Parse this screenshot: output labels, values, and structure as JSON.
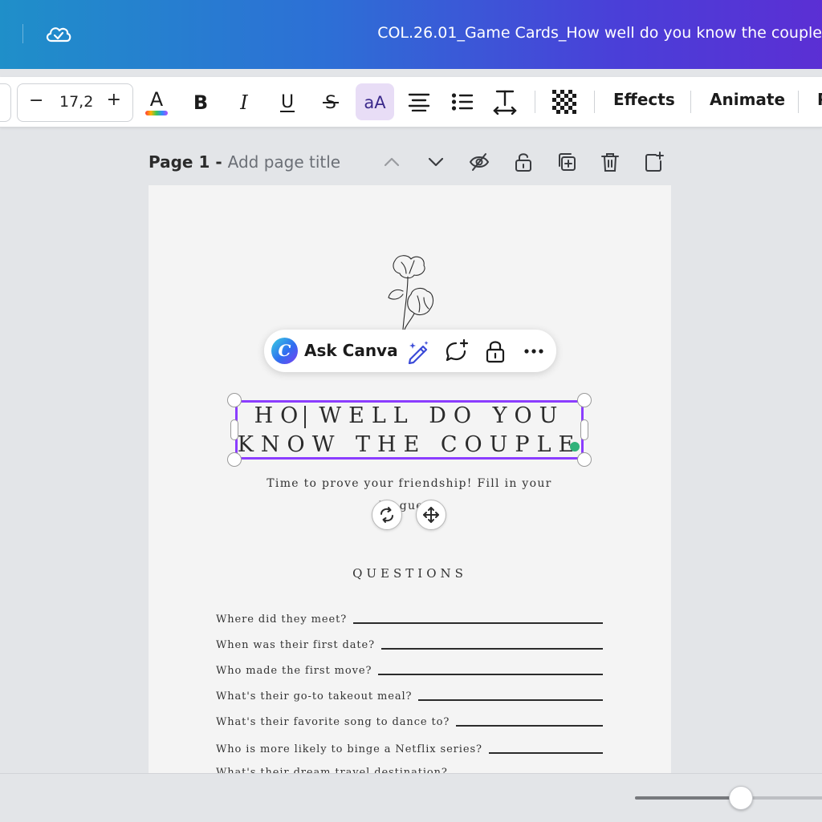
{
  "header": {
    "document_title": "COL.26.01_Game Cards_How well do you know the couple"
  },
  "toolbar": {
    "font_size_value": "17,2",
    "minus_label": "−",
    "plus_label": "+",
    "effects_label": "Effects",
    "animate_label": "Animate",
    "overflow_label": "P"
  },
  "page_header": {
    "page_number": "Page 1 - ",
    "page_title_placeholder": "Add page title"
  },
  "floating_toolbar": {
    "ask_label": "Ask Canva",
    "logo_letter": "C"
  },
  "document": {
    "heading_before_caret": "HO",
    "heading_after_caret": " WELL DO YOU",
    "heading_line2": "KNOW THE COUPLE",
    "subtitle_line1": "Time to prove your friendship! Fill in your",
    "subtitle_line2": "be   gue   s.",
    "questions_heading": "QUESTIONS",
    "questions": [
      "Where did they meet?",
      "When was their first date?",
      "Who made the first move?",
      "What's their go-to takeout meal?",
      "What's their favorite song to dance to?",
      "Who is more likely to binge a Netflix series?",
      "What's their dream travel destination?"
    ]
  },
  "zoom_slider": {
    "level": 0.55
  },
  "colors": {
    "selection": "#8b3dff",
    "active_button": "#e8ddf6",
    "header_gradient_start": "#1f8fc9",
    "header_gradient_end": "#5b2fd4"
  }
}
